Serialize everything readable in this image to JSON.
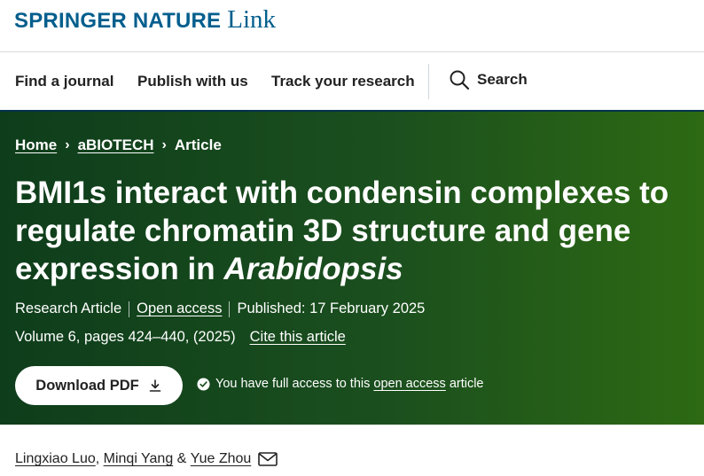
{
  "brand": {
    "main": "SPRINGER NATURE",
    "link": "Link",
    "color": "#025e8d"
  },
  "nav": {
    "items": [
      "Find a journal",
      "Publish with us",
      "Track your research"
    ],
    "search_label": "Search",
    "search_icon": "search-icon"
  },
  "breadcrumb": {
    "home": "Home",
    "journal": "aBIOTECH",
    "current": "Article",
    "separator": "›"
  },
  "article": {
    "title_main": "BMI1s interact with condensin complexes to regulate chromatin 3D structure and gene expression in ",
    "title_italic": "Arabidopsis",
    "type": "Research Article",
    "access": "Open access",
    "published": "Published: 17 February 2025",
    "volume": "Volume 6, pages 424–440, (2025)",
    "cite": "Cite this article"
  },
  "actions": {
    "download_pdf": "Download PDF",
    "access_prefix": "You have full access to this",
    "access_link": "open access",
    "access_suffix": "article"
  },
  "authors": {
    "names": [
      "Lingxiao Luo",
      "Minqi Yang",
      "Yue Zhou"
    ],
    "sep1": ", ",
    "sep2": " & ",
    "mail_icon": "envelope-icon"
  },
  "colors": {
    "hero_dark": "#0e3d1b",
    "hero_light": "#2d6a13",
    "text": "#222222"
  }
}
